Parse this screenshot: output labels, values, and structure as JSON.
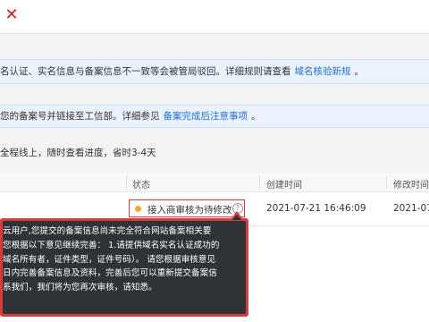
{
  "header": {
    "close_icon": "close-icon"
  },
  "notice_1": {
    "text": "名认证、实名信息与备案信息不一致等会被管局驳回。详细规则请查看",
    "link": "域名核验新规",
    "tail": "。"
  },
  "notice_2": {
    "text": "您的备案号并链接至工信部。详细参见",
    "link": "备案完成后注意事项",
    "tail": "。"
  },
  "progress_note": "全程线上，随时查看进度，省时3-4天",
  "table": {
    "headers": {
      "status": "状态",
      "created": "创建时间",
      "modified": "修改时间"
    },
    "row": {
      "status": "接入商审核为待修改",
      "status_color": "#f2a33a",
      "created": "2021-07-21 16:46:09",
      "modified": "2021-07-"
    }
  },
  "tooltip": {
    "lines": [
      "云用户,您提交的备案信息尚未完全符合网站备案相关要",
      "您根据以下意见继续完善：  1.请提供域名实名认证成功的",
      "域名所有者，证件类型，证件号码）。 请您根据审核意见",
      "日内完善备案信息及资料，完善后您可以重新提交备案信",
      "系我们，我们将为您再次审核，请知悉。"
    ]
  }
}
